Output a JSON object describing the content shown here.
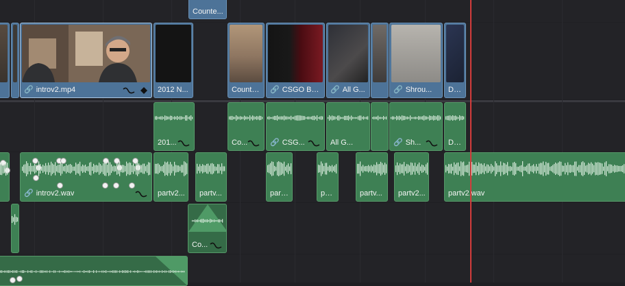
{
  "colors": {
    "video_clip": "#4d7398",
    "audio_clip": "#3e8054",
    "playhead": "#d43c3c",
    "background": "#1f1f23"
  },
  "video_track_2": {
    "clip_label": "Counte..."
  },
  "video_track_1": {
    "clips": [
      {
        "label": "introv2.mp4",
        "linked": true,
        "icons": [
          "link-icon",
          "curve-icon",
          "keyframe-diamond-icon"
        ]
      },
      {
        "label": "2012 N...",
        "linked": false
      },
      {
        "label": "Counte...",
        "linked": false
      },
      {
        "label": "CSGO Bo...",
        "linked": true
      },
      {
        "label": "All G...",
        "linked": true
      },
      {
        "label": "Shrou...",
        "linked": true
      },
      {
        "label": "Do..."
      }
    ]
  },
  "audio_track_1": {
    "clips": [
      {
        "label": "201..."
      },
      {
        "label": "Co..."
      },
      {
        "label": "CSG..."
      },
      {
        "label": "All G..."
      },
      {
        "label": "Sh..."
      },
      {
        "label": "Do..."
      }
    ]
  },
  "audio_track_2": {
    "clips": [
      {
        "label": "introv2.wav",
        "linked": true
      },
      {
        "label": "partv2..."
      },
      {
        "label": "partv..."
      },
      {
        "label": "part..."
      },
      {
        "label": "pa..."
      },
      {
        "label": "partv..."
      },
      {
        "label": "partv2..."
      },
      {
        "label": "partv2.wav"
      }
    ]
  },
  "audio_track_3": {
    "clips": [
      {
        "label": "Co..."
      }
    ]
  }
}
